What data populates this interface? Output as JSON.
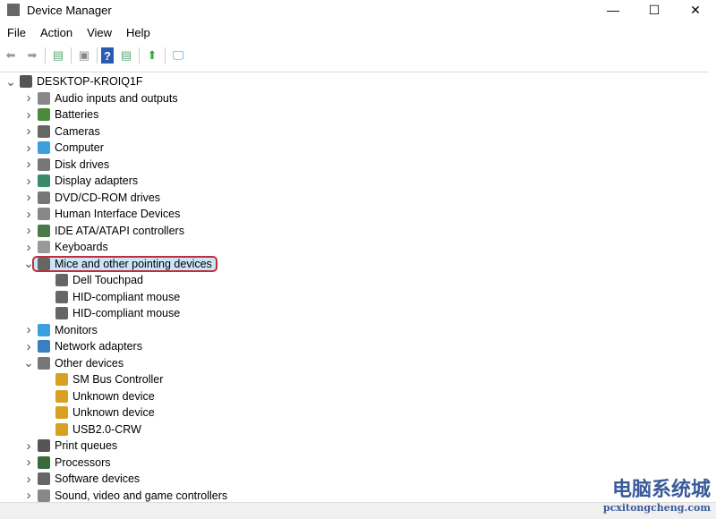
{
  "window": {
    "title": "Device Manager",
    "minimize": "—",
    "maximize": "☐",
    "close": "✕"
  },
  "menu": [
    "File",
    "Action",
    "View",
    "Help"
  ],
  "toolbar": [
    "back-icon",
    "forward-icon",
    "properties-icon",
    "show-hide-icon",
    "help-icon",
    "action-pane-icon",
    "update-driver-icon",
    "scan-hardware-icon"
  ],
  "tree": [
    {
      "label": "DESKTOP-KROIQ1F",
      "level": 0,
      "expanded": true,
      "color": "#555"
    },
    {
      "label": "Audio inputs and outputs",
      "level": 1,
      "color": "#888"
    },
    {
      "label": "Batteries",
      "level": 1,
      "color": "#4a8a3a"
    },
    {
      "label": "Cameras",
      "level": 1,
      "color": "#666"
    },
    {
      "label": "Computer",
      "level": 1,
      "color": "#3aa0e0"
    },
    {
      "label": "Disk drives",
      "level": 1,
      "color": "#777"
    },
    {
      "label": "Display adapters",
      "level": 1,
      "color": "#3a8a6a"
    },
    {
      "label": "DVD/CD-ROM drives",
      "level": 1,
      "color": "#777"
    },
    {
      "label": "Human Interface Devices",
      "level": 1,
      "color": "#888"
    },
    {
      "label": "IDE ATA/ATAPI controllers",
      "level": 1,
      "color": "#4a7a4a"
    },
    {
      "label": "Keyboards",
      "level": 1,
      "color": "#999"
    },
    {
      "label": "Mice and other pointing devices",
      "level": 1,
      "expanded": true,
      "selected": true,
      "color": "#666"
    },
    {
      "label": "Dell Touchpad",
      "level": 2,
      "color": "#666"
    },
    {
      "label": "HID-compliant mouse",
      "level": 2,
      "color": "#666"
    },
    {
      "label": "HID-compliant mouse",
      "level": 2,
      "color": "#666"
    },
    {
      "label": "Monitors",
      "level": 1,
      "color": "#3aa0e0"
    },
    {
      "label": "Network adapters",
      "level": 1,
      "color": "#3a80c0"
    },
    {
      "label": "Other devices",
      "level": 1,
      "expanded": true,
      "color": "#777"
    },
    {
      "label": "SM Bus Controller",
      "level": 2,
      "color": "#d8a020"
    },
    {
      "label": "Unknown device",
      "level": 2,
      "color": "#d8a020"
    },
    {
      "label": "Unknown device",
      "level": 2,
      "color": "#d8a020"
    },
    {
      "label": "USB2.0-CRW",
      "level": 2,
      "color": "#d8a020"
    },
    {
      "label": "Print queues",
      "level": 1,
      "color": "#555"
    },
    {
      "label": "Processors",
      "level": 1,
      "color": "#3a6a3a"
    },
    {
      "label": "Software devices",
      "level": 1,
      "color": "#666"
    },
    {
      "label": "Sound, video and game controllers",
      "level": 1,
      "color": "#888"
    }
  ],
  "watermark": {
    "cn": "电脑系统城",
    "en": "pcxitongcheng.com"
  }
}
